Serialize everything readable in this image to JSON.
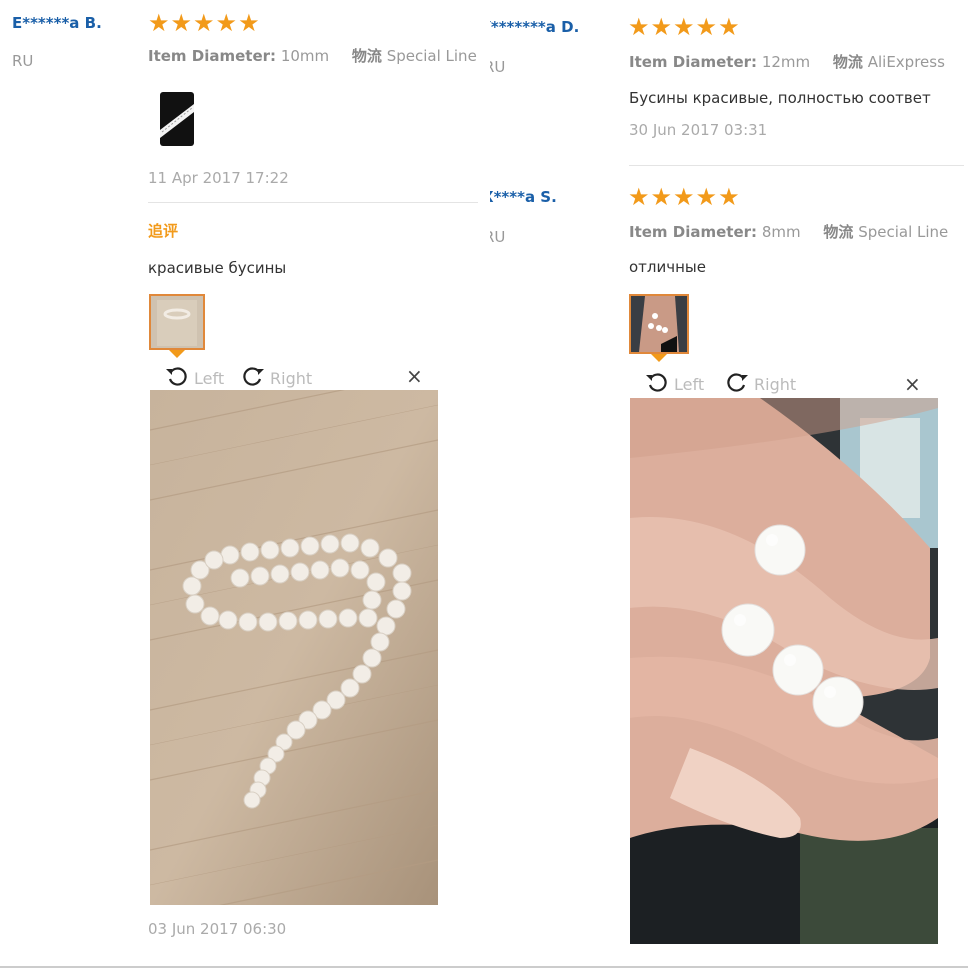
{
  "left": {
    "review1": {
      "user": "E******a B.",
      "country": "RU",
      "stars": "★★★★★",
      "diameter_label": "Item Diameter:",
      "diameter_value": "10mm",
      "shipping_label": "物流",
      "shipping_value": "Special Line",
      "date": "11 Apr 2017 17:22"
    },
    "followup": {
      "label": "追评",
      "text": "красивые бусины",
      "date": "03 Jun 2017 06:30"
    },
    "viewer": {
      "rotate_left": "Left",
      "rotate_right": "Right",
      "close": "×"
    }
  },
  "right": {
    "review1": {
      "user": "Y*******a D.",
      "country": "RU",
      "stars": "★★★★★",
      "diameter_label": "Item Diameter:",
      "diameter_value": "12mm",
      "shipping_label": "物流",
      "shipping_value": "AliExpress",
      "text": "Бусины красивые, полностью соответ",
      "date": "30 Jun 2017 03:31"
    },
    "review2": {
      "user": "X****a S.",
      "country": "RU",
      "stars": "★★★★★",
      "diameter_label": "Item Diameter:",
      "diameter_value": "8mm",
      "shipping_label": "物流",
      "shipping_value": "Special Line",
      "text": "отличные"
    },
    "viewer": {
      "rotate_left": "Left",
      "rotate_right": "Right",
      "close": "×"
    }
  },
  "colors": {
    "star": "#f29a1a",
    "username": "#1a5fa8",
    "thumb_border": "#e0883a"
  }
}
